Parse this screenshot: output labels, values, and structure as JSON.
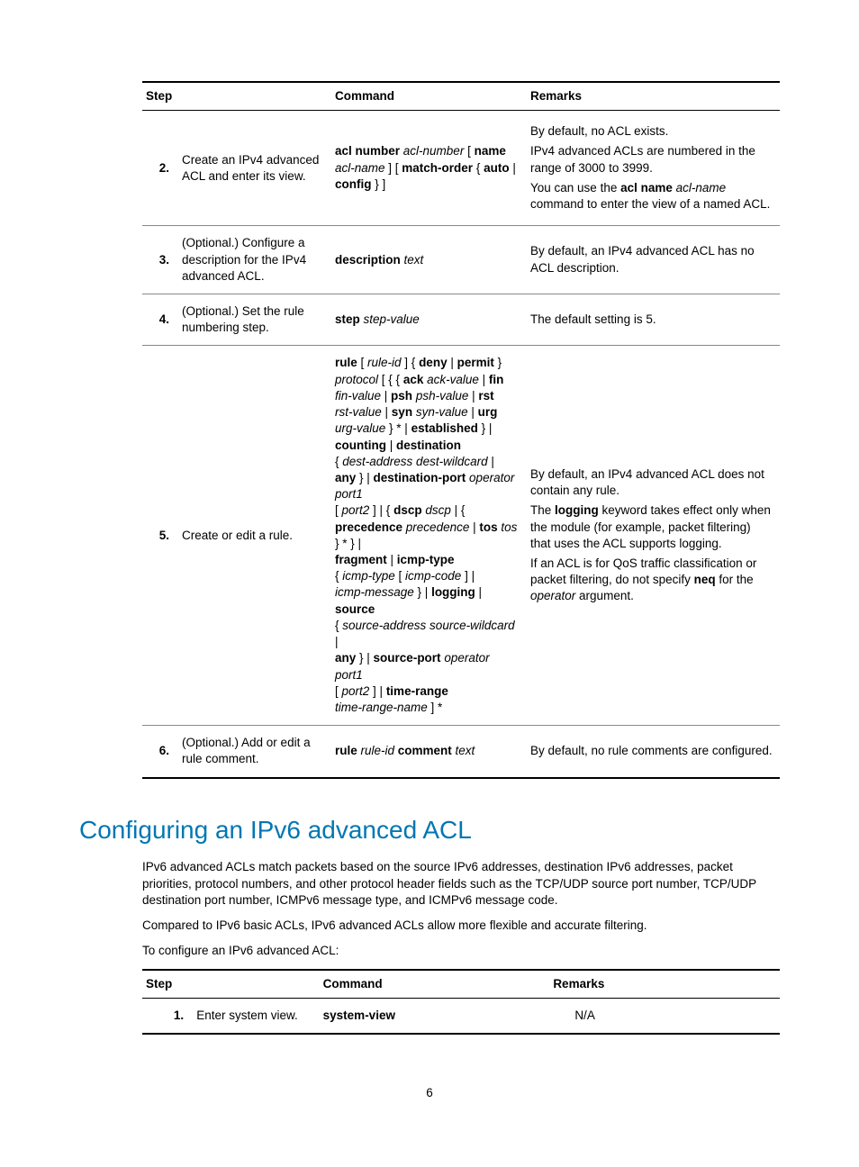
{
  "table1": {
    "headers": {
      "step": "Step",
      "command": "Command",
      "remarks": "Remarks"
    },
    "rows": [
      {
        "num": "2.",
        "step": "Create an IPv4 advanced ACL and enter its view.",
        "rem1": "By default, no ACL exists.",
        "rem2": "IPv4 advanced ACLs are numbered in the range of 3000 to 3999.",
        "rem3a": "You can use the ",
        "rem3b": "acl name",
        "rem3c": " acl-name",
        "rem3d": " command to enter the view of a named ACL."
      },
      {
        "num": "3.",
        "step": "(Optional.) Configure a description for the IPv4 advanced ACL.",
        "rem": "By default, an IPv4 advanced ACL has no ACL description."
      },
      {
        "num": "4.",
        "step": "(Optional.) Set the rule numbering step.",
        "rem": "The default setting is 5."
      },
      {
        "num": "5.",
        "step": "Create or edit a rule.",
        "rem1": "By default, an IPv4 advanced ACL does not contain any rule.",
        "rem2a": "The ",
        "rem2b": "logging",
        "rem2c": " keyword takes effect only when the module (for example, packet filtering) that uses the ACL supports logging.",
        "rem3a": "If an ACL is for QoS traffic classification or packet filtering, do not specify ",
        "rem3b": "neq",
        "rem3c": " for the ",
        "rem3d": "operator",
        "rem3e": " argument."
      },
      {
        "num": "6.",
        "step": "(Optional.) Add or edit a rule comment.",
        "rem": "By default, no rule comments are configured."
      }
    ]
  },
  "heading": "Configuring an IPv6 advanced ACL",
  "para1": "IPv6 advanced ACLs match packets based on the source IPv6 addresses, destination IPv6 addresses, packet priorities, protocol numbers, and other protocol header fields such as the TCP/UDP source port number, TCP/UDP destination port number, ICMPv6 message type, and ICMPv6 message code.",
  "para2": "Compared to IPv6 basic ACLs, IPv6 advanced ACLs allow more flexible and accurate filtering.",
  "para3": "To configure an IPv6 advanced ACL:",
  "table2": {
    "headers": {
      "step": "Step",
      "command": "Command",
      "remarks": "Remarks"
    },
    "row": {
      "num": "1.",
      "step": "Enter system view.",
      "command": "system-view",
      "remarks": "N/A"
    }
  },
  "pagenum": "6",
  "cmd": {
    "r2": {
      "p1": "acl number",
      "p2": " acl-number ",
      "p3": "[ ",
      "p4": "name",
      "p5": " acl-name ",
      "p6": "] [ ",
      "p7": "match-order",
      "p8": " { ",
      "p9": "auto",
      "p10": " | ",
      "p11": "config",
      "p12": " } ]"
    },
    "r3": {
      "p1": "description",
      "p2": " text"
    },
    "r4": {
      "p1": "step",
      "p2": " step-value"
    },
    "r6": {
      "p1": "rule",
      "p2": " rule-id ",
      "p3": "comment",
      "p4": " text"
    },
    "r5": {
      "a1": "rule",
      "a2": " [ ",
      "a3": "rule-id",
      "a4": " ] { ",
      "a5": "deny",
      "a6": " | ",
      "a7": "permit",
      "a8": " } ",
      "a9": "protocol",
      "a10": " [ { { ",
      "a11": "ack",
      "a12": " ack-value ",
      "a13": "| ",
      "a14": "fin",
      "a15": " fin-value ",
      "a16": "| ",
      "a17": "psh",
      "a18": " psh-value ",
      "a19": "| ",
      "a20": "rst",
      "a21": " rst-value ",
      "a22": "| ",
      "a23": "syn",
      "a24": " syn-value ",
      "a25": "| ",
      "a26": "urg",
      "a27": " urg-value ",
      "a28": "} * | ",
      "a29": "established",
      "a30": " } | ",
      "a31": "counting",
      "a32": " | ",
      "a33": "destination",
      "a34": " { ",
      "a35": "dest-address dest-wildcard",
      "a36": " | ",
      "a37": "any",
      "a38": " } | ",
      "a39": "destination-port",
      "a40": " operator port1 ",
      "a41": "[ ",
      "a42": "port2",
      "a43": " ] | { ",
      "a44": "dscp",
      "a45": " dscp ",
      "a46": "| { ",
      "a47": "precedence",
      "a48": " precedence ",
      "a49": "| ",
      "a50": "tos",
      "a51": " tos ",
      "a52": "} * } | ",
      "a53": "fragment",
      "a54": " | ",
      "a55": "icmp-type",
      "a56": " { ",
      "a57": "icmp-type",
      "a58": " [ ",
      "a59": "icmp-code",
      "a60": " ] | ",
      "a61": "icmp-message",
      "a62": " } | ",
      "a63": "logging",
      "a64": " | ",
      "a65": "source",
      "a66": " { ",
      "a67": "source-address source-wildcard",
      "a68": " | ",
      "a69": "any",
      "a70": " } | ",
      "a71": "source-port",
      "a72": " operator port1 ",
      "a73": "[ ",
      "a74": "port2",
      "a75": " ] | ",
      "a76": "time-range",
      "a77": " time-range-name ",
      "a78": "] *"
    }
  }
}
